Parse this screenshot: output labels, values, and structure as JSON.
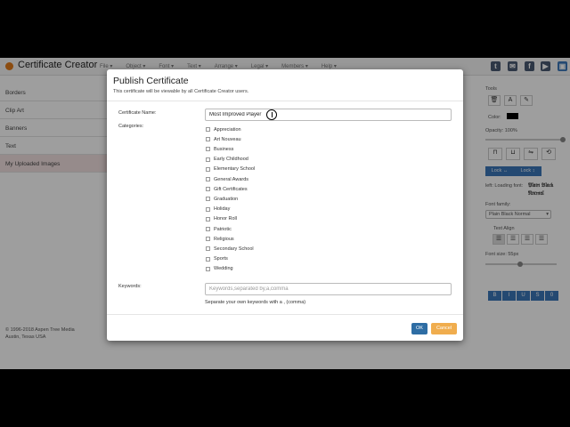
{
  "app": {
    "title": "Certificate Creator"
  },
  "menu": [
    "File ▾",
    "Object ▾",
    "Font ▾",
    "Text ▾",
    "Arrange ▾",
    "Legal ▾",
    "Members ▾",
    "Help ▾"
  ],
  "sidebar": {
    "items": [
      "Borders",
      "Clip Art",
      "Banners",
      "Text",
      "My Uploaded Images"
    ],
    "copyright_line1": "© 1996-2018 Aspen Tree Media",
    "copyright_line2": "Austin, Texas USA"
  },
  "tools": {
    "title": "Tools",
    "color_label": "Color:",
    "opacity_label": "Opacity: 100%",
    "lock_h": "Lock ↔",
    "lock_v": "Lock ↕",
    "loading_font": "left: Loading font:",
    "font_family_label": "Font family:",
    "font_family_value": "Plain Black Normal",
    "text_align_label": "Text Align",
    "font_size_label": "Font size: 55px",
    "style_buttons": [
      "B",
      "I",
      "U",
      "S",
      "0"
    ]
  },
  "modal": {
    "title": "Publish Certificate",
    "subtitle": "This certificate will be viewable by all Certificate Creator users.",
    "name_label": "Certificate Name:",
    "name_value": "Most Improved Player",
    "categories_label": "Categories:",
    "categories": [
      "Appreciation",
      "Art Nouveau",
      "Business",
      "Early Childhood",
      "Elementary School",
      "General Awards",
      "Gift Certificates",
      "Graduation",
      "Holiday",
      "Honor Roll",
      "Patriotic",
      "Religious",
      "Secondary School",
      "Sports",
      "Wedding"
    ],
    "keywords_label": "Keywords:",
    "keywords_placeholder": "Keywords,separated by,a,comma",
    "keywords_help": "Separate your own keywords with a , (comma)",
    "ok_label": "OK",
    "cancel_label": "Cancel"
  },
  "colors": {
    "primary": "#2e6da4",
    "cancel": "#f0ad4e",
    "accent": "#3a76b8",
    "logo": "#e07b1a"
  }
}
